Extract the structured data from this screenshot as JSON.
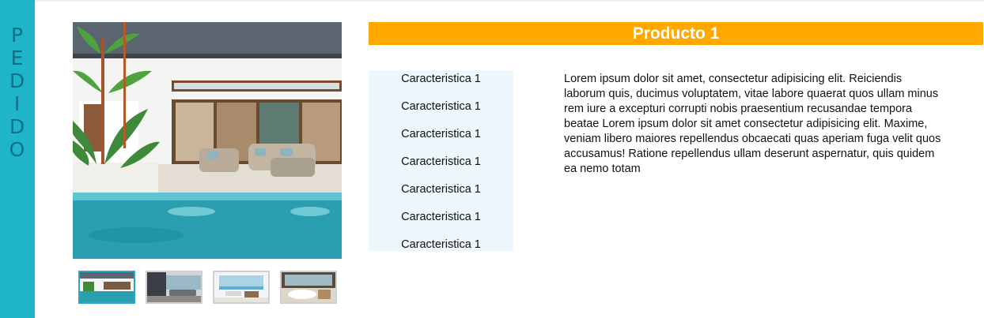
{
  "sidebar": {
    "label_letters": [
      "P",
      "E",
      "D",
      "I",
      "D",
      "O"
    ],
    "bg_color": "#1fb5c9",
    "text_color": "#0e6f8a"
  },
  "gallery": {
    "main_image": "villa-pool-patio-photo",
    "thumbnails": [
      {
        "image": "villa-pool-photo",
        "selected": true
      },
      {
        "image": "living-room-sea-view-photo",
        "selected": false
      },
      {
        "image": "white-interior-ocean-view-photo",
        "selected": false
      },
      {
        "image": "bathroom-bathtub-photo",
        "selected": false
      }
    ]
  },
  "product": {
    "title": "Producto 1",
    "title_bg": "#ffa900",
    "features": [
      "Caracteristica 1",
      "Caracteristica 1",
      "Caracteristica 1",
      "Caracteristica 1",
      "Caracteristica 1",
      "Caracteristica 1",
      "Caracteristica 1"
    ],
    "description": "Lorem ipsum dolor sit amet, consectetur adipisicing elit. Reiciendis laborum quis, ducimus voluptatem, vitae labore quaerat quos ullam minus rem iure a excepturi corrupti nobis praesentium recusandae tempora beatae Lorem ipsum dolor sit amet consectetur adipisicing elit. Maxime, veniam libero maiores repellendus obcaecati quas aperiam fuga velit quos accusamus! Ratione repellendus ullam deserunt aspernatur, quis quidem ea nemo totam"
  }
}
